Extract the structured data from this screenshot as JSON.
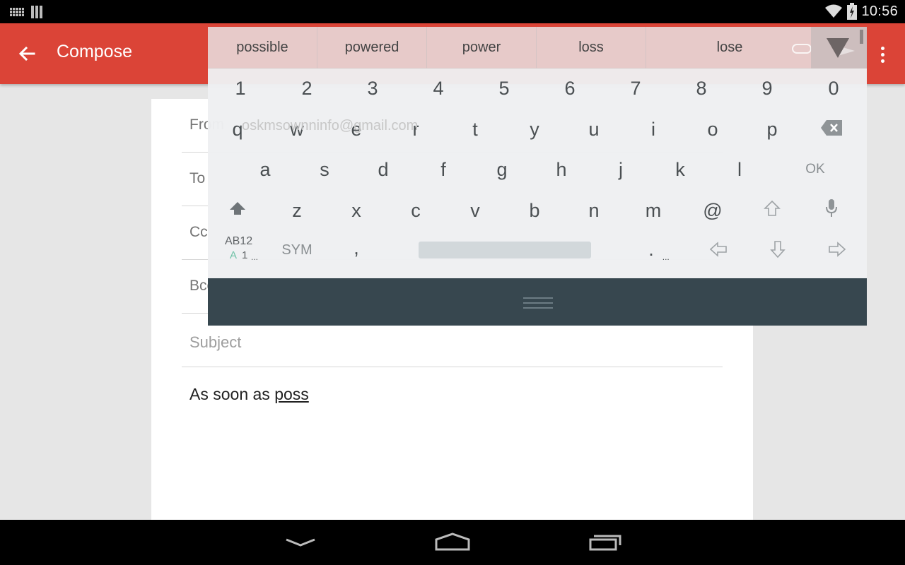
{
  "status_bar": {
    "time": "10:56",
    "icons": [
      "keyboard-notification-icon",
      "barcode-notification-icon",
      "wifi-icon",
      "battery-charging-icon"
    ]
  },
  "app_bar": {
    "title": "Compose",
    "back_icon": "arrow-left-icon",
    "attach_icon": "paperclip-icon",
    "send_icon": "send-icon",
    "overflow_icon": "more-vertical-icon",
    "color": "#db4437"
  },
  "compose": {
    "from_label": "From",
    "from_value": "oskmsownninfo@gmail.com",
    "to_label": "To",
    "cc_label": "Cc",
    "bcc_label": "Bcc",
    "subject_placeholder": "Subject",
    "body_prefix": "As soon as ",
    "body_composing": "poss"
  },
  "keyboard": {
    "suggestions": [
      "possible",
      "powered",
      "power",
      "loss",
      "lose"
    ],
    "collapse_icon": "triangle-down-icon",
    "number_row": [
      "1",
      "2",
      "3",
      "4",
      "5",
      "6",
      "7",
      "8",
      "9",
      "0"
    ],
    "row1": [
      "q",
      "w",
      "e",
      "r",
      "t",
      "y",
      "u",
      "i",
      "o",
      "p"
    ],
    "row2": [
      "a",
      "s",
      "d",
      "f",
      "g",
      "h",
      "j",
      "k",
      "l"
    ],
    "row3": [
      "z",
      "x",
      "c",
      "v",
      "b",
      "n",
      "m",
      "@"
    ],
    "backspace_icon": "backspace-icon",
    "ok_label": "OK",
    "shift_icon": "shift-filled-icon",
    "shift_outline_icon": "shift-outline-icon",
    "mic_icon": "microphone-icon",
    "mode_label_top": "AB12",
    "mode_label_a": "A",
    "mode_label_1": "1",
    "mode_label_more": "...",
    "sym_label": "SYM",
    "comma": ",",
    "period": ".",
    "period_more": "...",
    "arrow_left_icon": "arrow-left-outline-icon",
    "arrow_down_icon": "arrow-down-outline-icon",
    "arrow_right_icon": "arrow-right-outline-icon",
    "handle_icon": "drag-handle-icon"
  },
  "nav_bar": {
    "back_icon": "nav-back-chevron-icon",
    "home_icon": "nav-home-icon",
    "recents_icon": "nav-recents-icon"
  }
}
